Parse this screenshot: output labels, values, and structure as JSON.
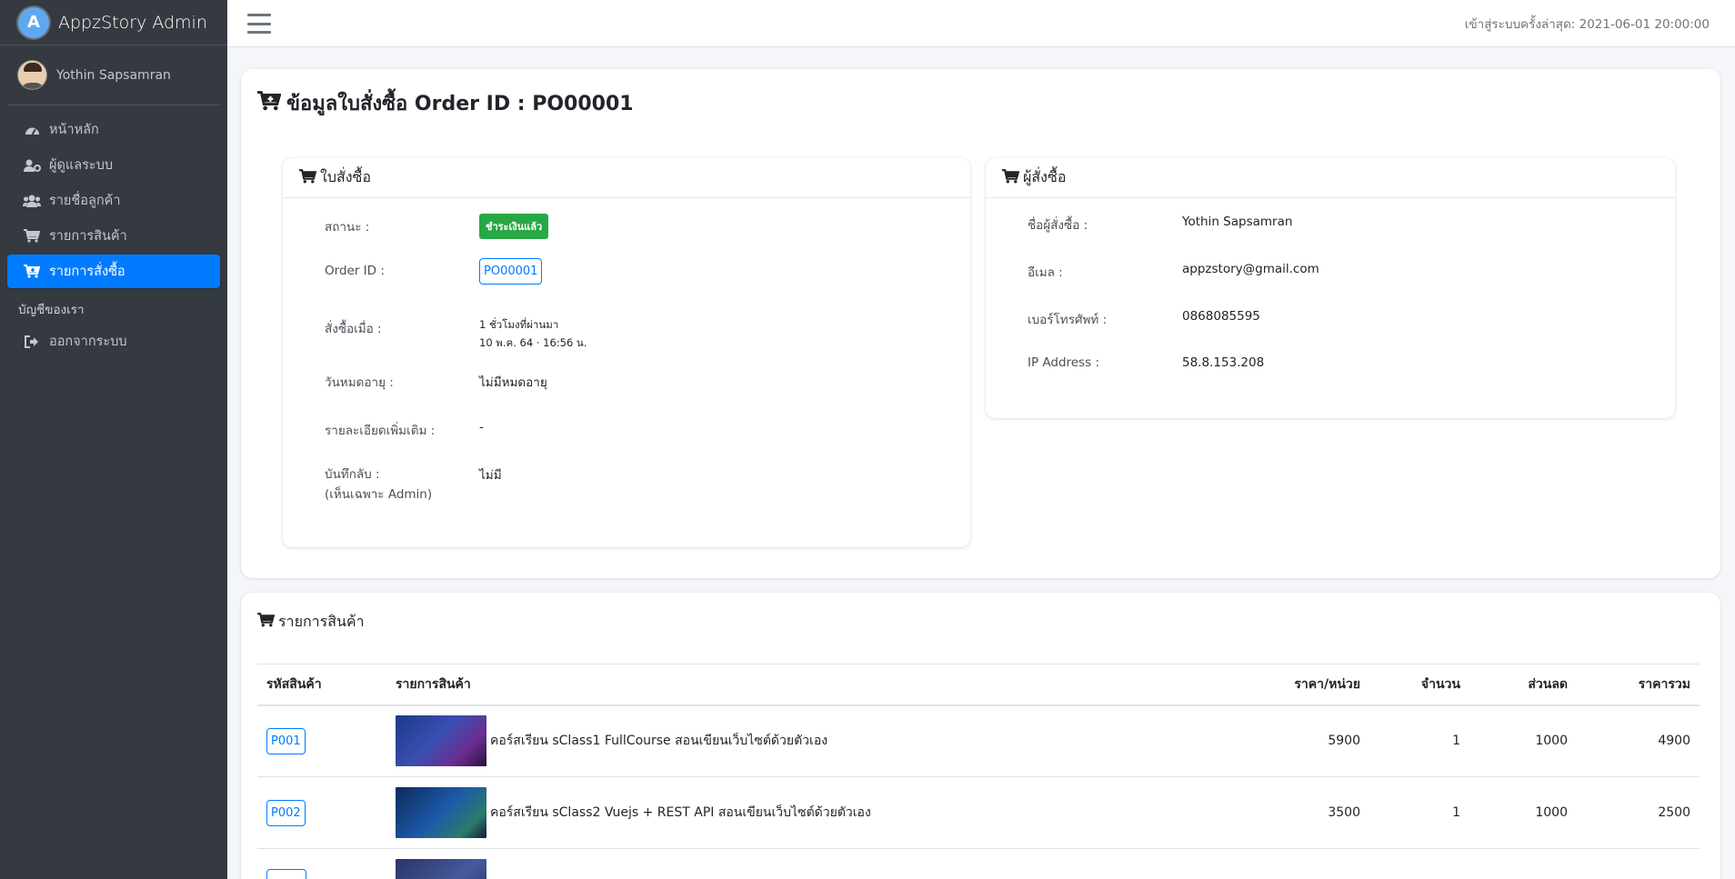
{
  "brand": {
    "title": "AppzStory Admin",
    "logo_letter": "A"
  },
  "user": {
    "name": "Yothin Sapsamran"
  },
  "sidebar": {
    "items": [
      {
        "label": "หน้าหลัก",
        "icon": "dashboard-icon"
      },
      {
        "label": "ผู้ดูแลระบบ",
        "icon": "user-cog-icon"
      },
      {
        "label": "รายชื่อลูกค้า",
        "icon": "users-icon"
      },
      {
        "label": "รายการสินค้า",
        "icon": "cart-icon"
      },
      {
        "label": "รายการสั่งซื้อ",
        "icon": "cart-plus-icon",
        "active": true
      }
    ],
    "section_header": "บัญชีของเรา",
    "logout": {
      "label": "ออกจากระบบ",
      "icon": "sign-out-icon"
    }
  },
  "topbar": {
    "last_login": "เข้าสู่ระบบครั้งล่าสุด: 2021-06-01 20:00:00"
  },
  "page": {
    "title": "ข้อมูลใบสั่งซื้อ Order ID : PO00001"
  },
  "order": {
    "header": "ใบสั่งซื้อ",
    "status_label": "สถานะ :",
    "status_value": "ชำระเงินแล้ว",
    "order_id_label": "Order ID :",
    "order_id_value": "PO00001",
    "ordered_at_label": "สั่งซื้อเมื่อ :",
    "ordered_at_relative": "1 ชั่วโมงที่ผ่านมา",
    "ordered_at_date": "10 พ.ค. 64 · 16:56 น.",
    "expire_label": "วันหมดอายุ :",
    "expire_value": "ไม่มีหมดอายุ",
    "details_label": "รายละเอียดเพิ่มเติม :",
    "details_value": "-",
    "note_label": "บันทึกลับ :",
    "note_sublabel": "(เห็นเฉพาะ Admin)",
    "note_value": "ไม่มี"
  },
  "buyer": {
    "header": "ผู้สั่งซื้อ",
    "name_label": "ชื่อผู้สั่งซื้อ :",
    "name_value": "Yothin Sapsamran",
    "email_label": "อีเมล :",
    "email_value": "appzstory@gmail.com",
    "phone_label": "เบอร์โทรศัพท์ :",
    "phone_value": "0868085595",
    "ip_label": "IP Address :",
    "ip_value": "58.8.153.208"
  },
  "products": {
    "header": "รายการสินค้า",
    "columns": [
      "รหัสสินค้า",
      "รายการสินค้า",
      "ราคา/หน่วย",
      "จำนวน",
      "ส่วนลด",
      "ราคารวม"
    ],
    "rows": [
      {
        "code": "P001",
        "name": "คอร์สเรียน sClass1 FullCourse สอนเขียนเว็บไซต์ด้วยตัวเอง",
        "price": "5900",
        "qty": "1",
        "discount": "1000",
        "total": "4900"
      },
      {
        "code": "P002",
        "name": "คอร์สเรียน sClass2 Vuejs + REST API สอนเขียนเว็บไซต์ด้วยตัวเอง",
        "price": "3500",
        "qty": "1",
        "discount": "1000",
        "total": "2500"
      },
      {
        "code": "",
        "name": "",
        "price": "",
        "qty": "",
        "discount": "",
        "total": ""
      }
    ]
  },
  "colors": {
    "sidebar_bg": "#343a40",
    "active": "#007bff",
    "paid_badge": "#28a745"
  }
}
